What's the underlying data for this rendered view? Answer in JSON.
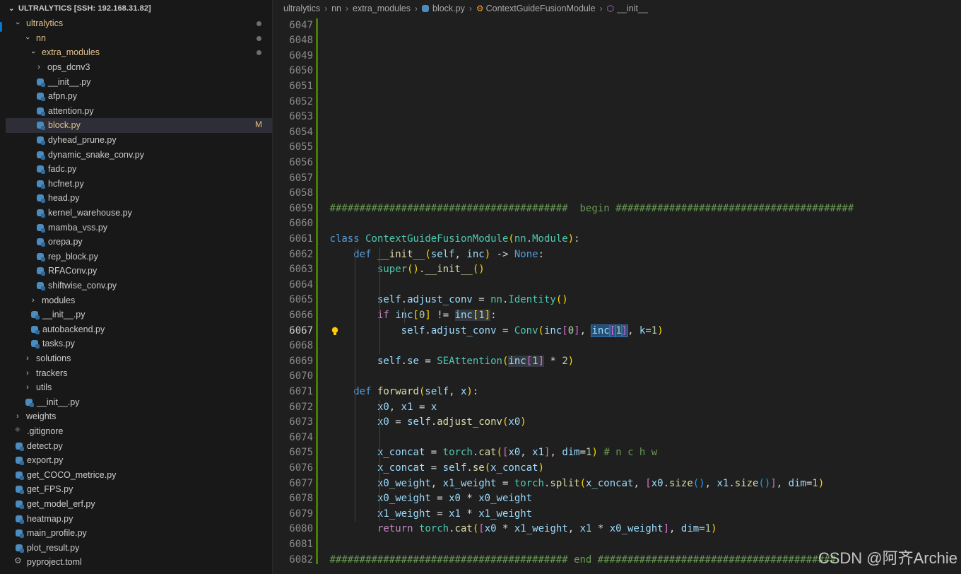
{
  "explorer": {
    "title": "ULTRALYTICS [SSH: 192.168.31.82]",
    "items": [
      {
        "label": "ultralytics",
        "kind": "folder",
        "open": true,
        "depth": 0,
        "mod": true,
        "dot": true
      },
      {
        "label": "nn",
        "kind": "folder",
        "open": true,
        "depth": 1,
        "mod": true,
        "dot": true
      },
      {
        "label": "extra_modules",
        "kind": "folder",
        "open": true,
        "depth": 2,
        "mod": true,
        "dot": true
      },
      {
        "label": "ops_dcnv3",
        "kind": "folder",
        "open": false,
        "depth": 3
      },
      {
        "label": "__init__.py",
        "kind": "py",
        "depth": 3
      },
      {
        "label": "afpn.py",
        "kind": "py",
        "depth": 3
      },
      {
        "label": "attention.py",
        "kind": "py",
        "depth": 3
      },
      {
        "label": "block.py",
        "kind": "py",
        "depth": 3,
        "mod": true,
        "badge": "M",
        "selected": true
      },
      {
        "label": "dyhead_prune.py",
        "kind": "py",
        "depth": 3
      },
      {
        "label": "dynamic_snake_conv.py",
        "kind": "py",
        "depth": 3
      },
      {
        "label": "fadc.py",
        "kind": "py",
        "depth": 3
      },
      {
        "label": "hcfnet.py",
        "kind": "py",
        "depth": 3
      },
      {
        "label": "head.py",
        "kind": "py",
        "depth": 3
      },
      {
        "label": "kernel_warehouse.py",
        "kind": "py",
        "depth": 3
      },
      {
        "label": "mamba_vss.py",
        "kind": "py",
        "depth": 3
      },
      {
        "label": "orepa.py",
        "kind": "py",
        "depth": 3
      },
      {
        "label": "rep_block.py",
        "kind": "py",
        "depth": 3
      },
      {
        "label": "RFAConv.py",
        "kind": "py",
        "depth": 3
      },
      {
        "label": "shiftwise_conv.py",
        "kind": "py",
        "depth": 3
      },
      {
        "label": "modules",
        "kind": "folder",
        "open": false,
        "depth": 2
      },
      {
        "label": "__init__.py",
        "kind": "py",
        "depth": 2
      },
      {
        "label": "autobackend.py",
        "kind": "py",
        "depth": 2
      },
      {
        "label": "tasks.py",
        "kind": "py",
        "depth": 2
      },
      {
        "label": "solutions",
        "kind": "folder",
        "open": false,
        "depth": 1
      },
      {
        "label": "trackers",
        "kind": "folder",
        "open": false,
        "depth": 1
      },
      {
        "label": "utils",
        "kind": "folder",
        "open": false,
        "depth": 1
      },
      {
        "label": "__init__.py",
        "kind": "py",
        "depth": 1
      },
      {
        "label": "weights",
        "kind": "folder",
        "open": false,
        "depth": 0
      },
      {
        "label": ".gitignore",
        "kind": "git",
        "depth": 0
      },
      {
        "label": "detect.py",
        "kind": "py",
        "depth": 0
      },
      {
        "label": "export.py",
        "kind": "py",
        "depth": 0
      },
      {
        "label": "get_COCO_metrice.py",
        "kind": "py",
        "depth": 0
      },
      {
        "label": "get_FPS.py",
        "kind": "py",
        "depth": 0
      },
      {
        "label": "get_model_erf.py",
        "kind": "py",
        "depth": 0
      },
      {
        "label": "heatmap.py",
        "kind": "py",
        "depth": 0
      },
      {
        "label": "main_profile.py",
        "kind": "py",
        "depth": 0
      },
      {
        "label": "plot_result.py",
        "kind": "py",
        "depth": 0
      },
      {
        "label": "pyproject.toml",
        "kind": "gear",
        "depth": 0
      }
    ]
  },
  "breadcrumb": {
    "parts": [
      "ultralytics",
      "nn",
      "extra_modules",
      "block.py",
      "ContextGuideFusionModule",
      "__init__"
    ]
  },
  "editor": {
    "current_line": "6067",
    "lines": [
      {
        "n": "6047",
        "t": []
      },
      {
        "n": "6048",
        "t": []
      },
      {
        "n": "6049",
        "t": []
      },
      {
        "n": "6050",
        "t": []
      },
      {
        "n": "6051",
        "t": []
      },
      {
        "n": "6052",
        "t": []
      },
      {
        "n": "6053",
        "t": []
      },
      {
        "n": "6054",
        "t": []
      },
      {
        "n": "6055",
        "t": []
      },
      {
        "n": "6056",
        "t": []
      },
      {
        "n": "6057",
        "t": []
      },
      {
        "n": "6058",
        "t": []
      },
      {
        "n": "6059",
        "t": [
          [
            "c-cmt",
            "########################################  begin ########################################"
          ]
        ]
      },
      {
        "n": "6060",
        "t": []
      },
      {
        "n": "6061",
        "t": [
          [
            "c-kw",
            "class"
          ],
          [
            "",
            " "
          ],
          [
            "c-cls",
            "ContextGuideFusionModule"
          ],
          [
            "c-b1",
            "("
          ],
          [
            "c-cls",
            "nn"
          ],
          [
            "c-op",
            "."
          ],
          [
            "c-cls",
            "Module"
          ],
          [
            "c-b1",
            ")"
          ],
          [
            "c-op",
            ":"
          ]
        ]
      },
      {
        "n": "6062",
        "t": [
          [
            "",
            "    "
          ],
          [
            "c-kw",
            "def"
          ],
          [
            "",
            " "
          ],
          [
            "c-fn",
            "__init__"
          ],
          [
            "c-b1",
            "("
          ],
          [
            "c-var",
            "self"
          ],
          [
            "c-op",
            ", "
          ],
          [
            "c-var",
            "inc"
          ],
          [
            "c-b1",
            ")"
          ],
          [
            "c-op",
            " -> "
          ],
          [
            "c-kw",
            "None"
          ],
          [
            "c-op",
            ":"
          ]
        ]
      },
      {
        "n": "6063",
        "t": [
          [
            "",
            "        "
          ],
          [
            "c-cls",
            "super"
          ],
          [
            "c-b1",
            "()"
          ],
          [
            "c-op",
            "."
          ],
          [
            "c-fn",
            "__init__"
          ],
          [
            "c-b1",
            "()"
          ]
        ]
      },
      {
        "n": "6064",
        "t": []
      },
      {
        "n": "6065",
        "t": [
          [
            "",
            "        "
          ],
          [
            "c-var",
            "self"
          ],
          [
            "c-op",
            "."
          ],
          [
            "c-var",
            "adjust_conv"
          ],
          [
            "c-op",
            " = "
          ],
          [
            "c-cls",
            "nn"
          ],
          [
            "c-op",
            "."
          ],
          [
            "c-cls",
            "Identity"
          ],
          [
            "c-b1",
            "()"
          ]
        ]
      },
      {
        "n": "6066",
        "t": [
          [
            "",
            "        "
          ],
          [
            "c-ctl",
            "if"
          ],
          [
            "",
            " "
          ],
          [
            "c-var",
            "inc"
          ],
          [
            "c-b1",
            "["
          ],
          [
            "c-num",
            "0"
          ],
          [
            "c-b1",
            "]"
          ],
          [
            "c-op",
            " != "
          ],
          [
            "c-var hl2",
            "inc"
          ],
          [
            "c-b1 hl2",
            "["
          ],
          [
            "c-num hl2",
            "1"
          ],
          [
            "c-b1 hl2",
            "]"
          ],
          [
            "c-op",
            ":"
          ]
        ]
      },
      {
        "n": "6067",
        "t": [
          [
            "",
            "            "
          ],
          [
            "c-var",
            "self"
          ],
          [
            "c-op",
            "."
          ],
          [
            "c-var",
            "adjust_conv"
          ],
          [
            "c-op",
            " = "
          ],
          [
            "c-cls",
            "Conv"
          ],
          [
            "c-b1",
            "("
          ],
          [
            "c-var",
            "inc"
          ],
          [
            "c-b2",
            "["
          ],
          [
            "c-num",
            "0"
          ],
          [
            "c-b2",
            "]"
          ],
          [
            "c-op",
            ", "
          ],
          [
            "c-var hl",
            "inc"
          ],
          [
            "c-b2 hl",
            "["
          ],
          [
            "c-num hl",
            "1"
          ],
          [
            "c-b2 hl",
            "]"
          ],
          [
            "c-op",
            ", "
          ],
          [
            "c-var",
            "k"
          ],
          [
            "c-op",
            "="
          ],
          [
            "c-num",
            "1"
          ],
          [
            "c-b1",
            ")"
          ]
        ]
      },
      {
        "n": "6068",
        "t": []
      },
      {
        "n": "6069",
        "t": [
          [
            "",
            "        "
          ],
          [
            "c-var",
            "self"
          ],
          [
            "c-op",
            "."
          ],
          [
            "c-var",
            "se"
          ],
          [
            "c-op",
            " = "
          ],
          [
            "c-cls",
            "SEAttention"
          ],
          [
            "c-b1",
            "("
          ],
          [
            "c-var hl2",
            "inc"
          ],
          [
            "c-b2 hl2",
            "["
          ],
          [
            "c-num hl2",
            "1"
          ],
          [
            "c-b2 hl2",
            "]"
          ],
          [
            "c-op",
            " * "
          ],
          [
            "c-num",
            "2"
          ],
          [
            "c-b1",
            ")"
          ]
        ]
      },
      {
        "n": "6070",
        "t": []
      },
      {
        "n": "6071",
        "t": [
          [
            "",
            "    "
          ],
          [
            "c-kw",
            "def"
          ],
          [
            "",
            " "
          ],
          [
            "c-fn",
            "forward"
          ],
          [
            "c-b1",
            "("
          ],
          [
            "c-var",
            "self"
          ],
          [
            "c-op",
            ", "
          ],
          [
            "c-var",
            "x"
          ],
          [
            "c-b1",
            ")"
          ],
          [
            "c-op",
            ":"
          ]
        ]
      },
      {
        "n": "6072",
        "t": [
          [
            "",
            "        "
          ],
          [
            "c-var",
            "x0"
          ],
          [
            "c-op",
            ", "
          ],
          [
            "c-var",
            "x1"
          ],
          [
            "c-op",
            " = "
          ],
          [
            "c-var",
            "x"
          ]
        ]
      },
      {
        "n": "6073",
        "t": [
          [
            "",
            "        "
          ],
          [
            "c-var",
            "x0"
          ],
          [
            "c-op",
            " = "
          ],
          [
            "c-var",
            "self"
          ],
          [
            "c-op",
            "."
          ],
          [
            "c-fn",
            "adjust_conv"
          ],
          [
            "c-b1",
            "("
          ],
          [
            "c-var",
            "x0"
          ],
          [
            "c-b1",
            ")"
          ]
        ]
      },
      {
        "n": "6074",
        "t": []
      },
      {
        "n": "6075",
        "t": [
          [
            "",
            "        "
          ],
          [
            "c-var",
            "x_concat"
          ],
          [
            "c-op",
            " = "
          ],
          [
            "c-cls",
            "torch"
          ],
          [
            "c-op",
            "."
          ],
          [
            "c-fn",
            "cat"
          ],
          [
            "c-b1",
            "("
          ],
          [
            "c-b2",
            "["
          ],
          [
            "c-var",
            "x0"
          ],
          [
            "c-op",
            ", "
          ],
          [
            "c-var",
            "x1"
          ],
          [
            "c-b2",
            "]"
          ],
          [
            "c-op",
            ", "
          ],
          [
            "c-var",
            "dim"
          ],
          [
            "c-op",
            "="
          ],
          [
            "c-num",
            "1"
          ],
          [
            "c-b1",
            ")"
          ],
          [
            "",
            " "
          ],
          [
            "c-cmt",
            "# n c h w"
          ]
        ]
      },
      {
        "n": "6076",
        "t": [
          [
            "",
            "        "
          ],
          [
            "c-var",
            "x_concat"
          ],
          [
            "c-op",
            " = "
          ],
          [
            "c-var",
            "self"
          ],
          [
            "c-op",
            "."
          ],
          [
            "c-fn",
            "se"
          ],
          [
            "c-b1",
            "("
          ],
          [
            "c-var",
            "x_concat"
          ],
          [
            "c-b1",
            ")"
          ]
        ]
      },
      {
        "n": "6077",
        "t": [
          [
            "",
            "        "
          ],
          [
            "c-var",
            "x0_weight"
          ],
          [
            "c-op",
            ", "
          ],
          [
            "c-var",
            "x1_weight"
          ],
          [
            "c-op",
            " = "
          ],
          [
            "c-cls",
            "torch"
          ],
          [
            "c-op",
            "."
          ],
          [
            "c-fn",
            "split"
          ],
          [
            "c-b1",
            "("
          ],
          [
            "c-var",
            "x_concat"
          ],
          [
            "c-op",
            ", "
          ],
          [
            "c-b2",
            "["
          ],
          [
            "c-var",
            "x0"
          ],
          [
            "c-op",
            "."
          ],
          [
            "c-fn",
            "size"
          ],
          [
            "c-b3",
            "()"
          ],
          [
            "c-op",
            ", "
          ],
          [
            "c-var",
            "x1"
          ],
          [
            "c-op",
            "."
          ],
          [
            "c-fn",
            "size"
          ],
          [
            "c-b3",
            "()"
          ],
          [
            "c-b2",
            "]"
          ],
          [
            "c-op",
            ", "
          ],
          [
            "c-var",
            "dim"
          ],
          [
            "c-op",
            "="
          ],
          [
            "c-num",
            "1"
          ],
          [
            "c-b1",
            ")"
          ]
        ]
      },
      {
        "n": "6078",
        "t": [
          [
            "",
            "        "
          ],
          [
            "c-var",
            "x0_weight"
          ],
          [
            "c-op",
            " = "
          ],
          [
            "c-var",
            "x0"
          ],
          [
            "c-op",
            " * "
          ],
          [
            "c-var",
            "x0_weight"
          ]
        ]
      },
      {
        "n": "6079",
        "t": [
          [
            "",
            "        "
          ],
          [
            "c-var",
            "x1_weight"
          ],
          [
            "c-op",
            " = "
          ],
          [
            "c-var",
            "x1"
          ],
          [
            "c-op",
            " * "
          ],
          [
            "c-var",
            "x1_weight"
          ]
        ]
      },
      {
        "n": "6080",
        "t": [
          [
            "",
            "        "
          ],
          [
            "c-ctl",
            "return"
          ],
          [
            "",
            " "
          ],
          [
            "c-cls",
            "torch"
          ],
          [
            "c-op",
            "."
          ],
          [
            "c-fn",
            "cat"
          ],
          [
            "c-b1",
            "("
          ],
          [
            "c-b2",
            "["
          ],
          [
            "c-var",
            "x0"
          ],
          [
            "c-op",
            " * "
          ],
          [
            "c-var",
            "x1_weight"
          ],
          [
            "c-op",
            ", "
          ],
          [
            "c-var",
            "x1"
          ],
          [
            "c-op",
            " * "
          ],
          [
            "c-var",
            "x0_weight"
          ],
          [
            "c-b2",
            "]"
          ],
          [
            "c-op",
            ", "
          ],
          [
            "c-var",
            "dim"
          ],
          [
            "c-op",
            "="
          ],
          [
            "c-num",
            "1"
          ],
          [
            "c-b1",
            ")"
          ]
        ]
      },
      {
        "n": "6081",
        "t": []
      },
      {
        "n": "6082",
        "t": [
          [
            "c-cmt",
            "######################################## end ########################################"
          ]
        ]
      }
    ]
  },
  "watermark": "CSDN @阿齐Archie"
}
